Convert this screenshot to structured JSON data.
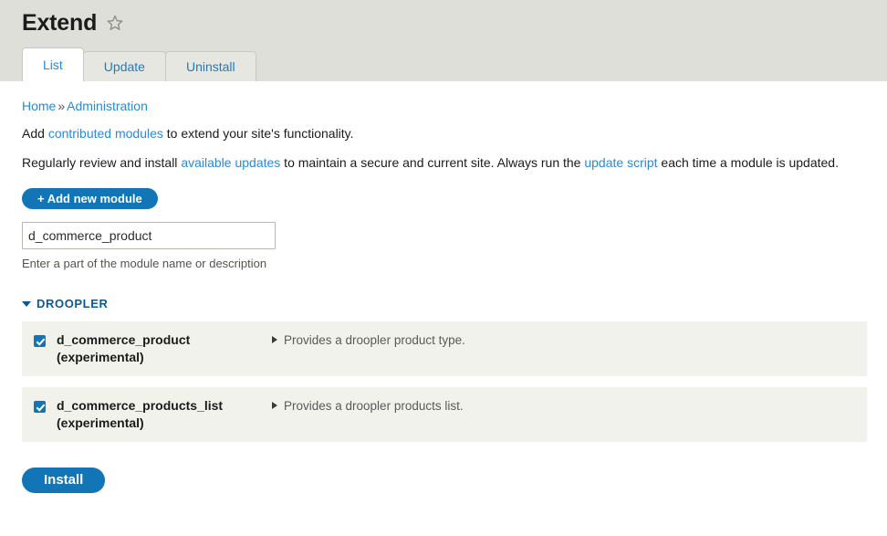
{
  "header": {
    "title": "Extend",
    "star_icon": "star-outline-icon"
  },
  "tabs": [
    {
      "label": "List",
      "active": true
    },
    {
      "label": "Update",
      "active": false
    },
    {
      "label": "Uninstall",
      "active": false
    }
  ],
  "breadcrumb": {
    "items": [
      "Home",
      "Administration"
    ],
    "separator": "»"
  },
  "intro": {
    "line1_prefix": "Add ",
    "line1_link": "contributed modules",
    "line1_suffix": " to extend your site's functionality.",
    "line2_prefix": "Regularly review and install ",
    "line2_link1": "available updates",
    "line2_mid": " to maintain a secure and current site. Always run the ",
    "line2_link2": "update script",
    "line2_suffix": " each time a module is updated."
  },
  "add_module_button": {
    "label": "+ Add new module"
  },
  "filter": {
    "value": "d_commerce_product",
    "placeholder": "",
    "description": "Enter a part of the module name or description"
  },
  "package": {
    "name": "DROOPLER",
    "toggle_icon": "chevron-down-icon",
    "expanded": true
  },
  "modules": [
    {
      "checked": true,
      "name": "d_commerce_product (experimental)",
      "description": "Provides a droopler product type.",
      "expand_icon": "chevron-right-icon"
    },
    {
      "checked": true,
      "name": "d_commerce_products_list (experimental)",
      "description": "Provides a droopler products list.",
      "expand_icon": "chevron-right-icon"
    }
  ],
  "install_button": {
    "label": "Install"
  },
  "colors": {
    "header_bg": "#dfdfd9",
    "link": "#2a8bd4",
    "primary_button": "#1275b5",
    "package_title": "#0d5a8f",
    "row_bg": "#f2f2ed"
  }
}
